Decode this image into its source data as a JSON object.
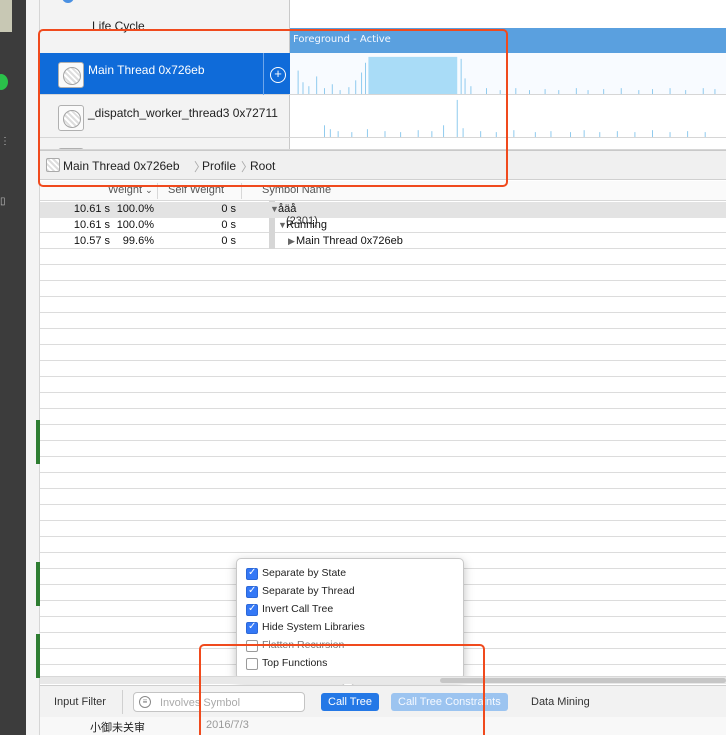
{
  "lifecycle_label": "Life Cycle",
  "state_lane_label": "Foreground - Active",
  "tracks": [
    {
      "name": "Main Thread  0x726eb",
      "selected": true
    },
    {
      "name": "_dispatch_worker_thread3  0x72711",
      "selected": false
    }
  ],
  "breadcrumb": [
    "Main Thread  0x726eb",
    "Profile",
    "Root"
  ],
  "columns": {
    "weight": "Weight",
    "self_weight": "Self Weight",
    "symbol": "Symbol Name"
  },
  "rows": [
    {
      "weight": "10.61 s",
      "percent": "100.0%",
      "self": "0 s",
      "symbol": "åäå"
    },
    {
      "weight": "10.61 s",
      "percent": "100.0%",
      "self": "0 s",
      "symbol": "Running",
      "overlay": "(2301)"
    },
    {
      "weight": "10.57 s",
      "percent": "99.6%",
      "self": "0 s",
      "symbol": "Main Thread  0x726eb"
    }
  ],
  "options": [
    {
      "label": "Separate by State",
      "checked": true
    },
    {
      "label": "Separate by Thread",
      "checked": true
    },
    {
      "label": "Invert Call Tree",
      "checked": true
    },
    {
      "label": "Hide System Libraries",
      "checked": true
    },
    {
      "label": "Flatten Recursion",
      "checked": false
    },
    {
      "label": "Top Functions",
      "checked": false
    }
  ],
  "bottom": {
    "input_filter": "Input Filter",
    "search_placeholder": "Involves Symbol",
    "call_tree": "Call Tree",
    "constraints": "Call Tree Constraints",
    "data_mining": "Data Mining"
  },
  "below_window": {
    "text_left": "小御未关审",
    "text_right": "2016/7/3"
  },
  "colors": {
    "selection": "#0f6bd9",
    "lane": "#5aa0df",
    "annotation": "#f04a1d",
    "accent": "#2478e6"
  }
}
